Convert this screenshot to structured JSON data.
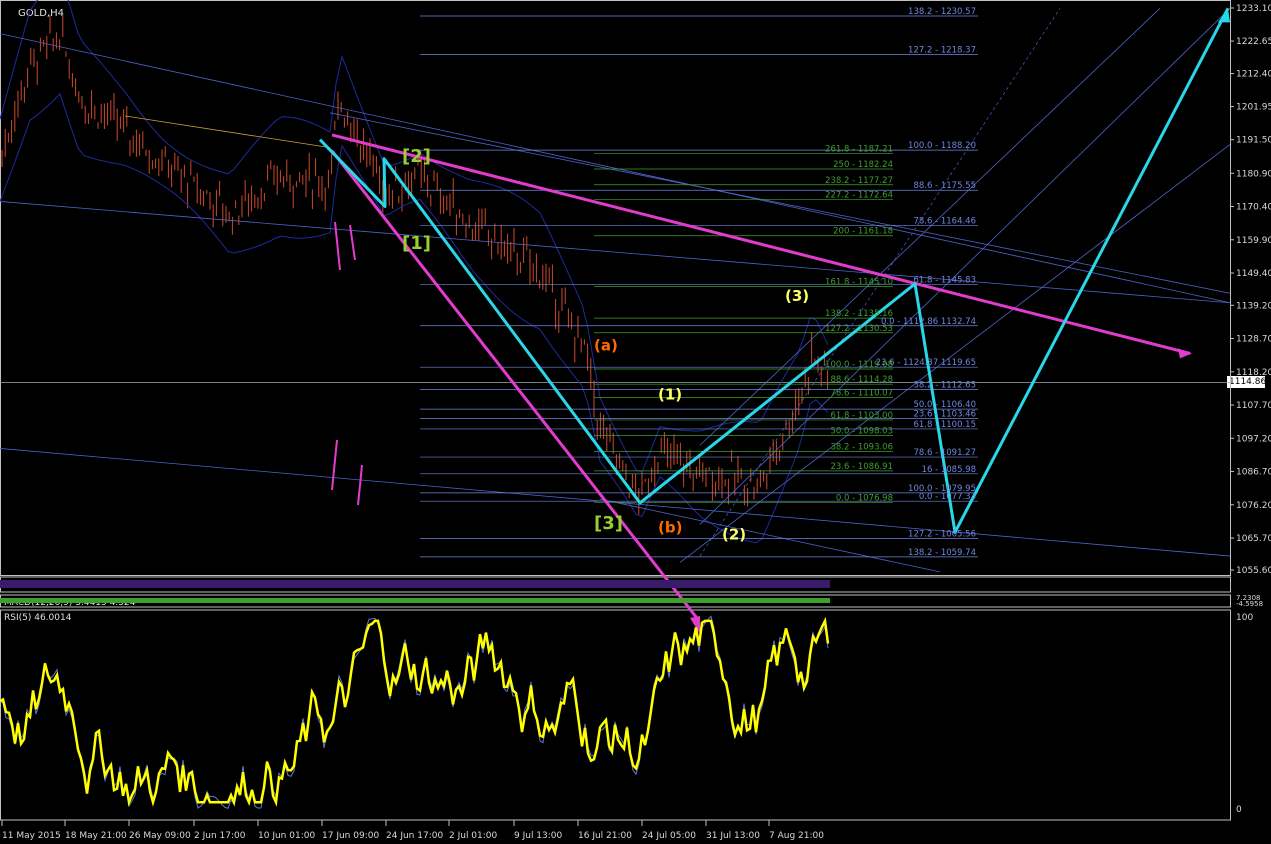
{
  "window": {
    "symbol_label": "GOLD,H4",
    "macd_label": "MACD(12,26,9) 3.4415 4.324",
    "rsi_label": "RSI(5) 46.0014",
    "current_price": "1114.86"
  },
  "colors": {
    "background": "#000000",
    "grid_axis": "#c0c0c0",
    "candle": "#cc4a2b",
    "bollinger": "#1e2a9e",
    "trend_blue": "#4d64c8",
    "fib_blue": "#6f86e0",
    "fib_green": "#3f9f2f",
    "cyan_path": "#28d7e8",
    "magenta": "#e23ccd",
    "rsi_yellow": "#ffff00",
    "rsi_blue": "#5f7bd6",
    "wave_yellow": "#ffff66",
    "wave_orange": "#ff6a00",
    "wave_green": "#9acd32"
  },
  "chart_data": {
    "type": "line",
    "title": "GOLD,H4",
    "price_axis_ticks": [
      "1233.10",
      "1222.65",
      "1212.40",
      "1201.95",
      "1191.50",
      "1180.90",
      "1170.40",
      "1159.90",
      "1149.40",
      "1139.20",
      "1128.70",
      "1118.20",
      "1107.70",
      "1097.20",
      "1086.70",
      "1076.20",
      "1065.70",
      "1055.60"
    ],
    "time_axis_ticks": [
      "11 May 2015",
      "18 May 21:00",
      "26 May 09:00",
      "2 Jun 17:00",
      "10 Jun 01:00",
      "17 Jun 09:00",
      "24 Jun 17:00",
      "2 Jul 01:00",
      "9 Jul 13:00",
      "16 Jul 21:00",
      "24 Jul 05:00",
      "31 Jul 13:00",
      "7 Aug 21:00"
    ],
    "ylim": [
      1055.6,
      1233.1
    ],
    "rsi_ticks": [
      "100",
      "0"
    ],
    "macd_ticks": [
      "7.2308",
      "-4.5958"
    ],
    "fib_levels_right": [
      {
        "label": "138.2 - 1230.57",
        "price": 1230.57
      },
      {
        "label": "127.2 - 1218.37",
        "price": 1218.37
      },
      {
        "label": "100.0 - 1188.20",
        "price": 1188.2
      },
      {
        "label": "88.6 - 1175.55",
        "price": 1175.55
      },
      {
        "label": "78.6 - 1164.46",
        "price": 1164.46
      },
      {
        "label": "61.8 - 1145.83",
        "price": 1145.83
      },
      {
        "label": "0.0 - 1112.86 1132.74",
        "price": 1132.74
      },
      {
        "label": "23.6 - 1124.37 1119.65",
        "price": 1119.65
      },
      {
        "label": "38.2 - 1112.65",
        "price": 1112.65
      },
      {
        "label": "50.0 - 1106.40",
        "price": 1106.4
      },
      {
        "label": "23.6 - 1103.46",
        "price": 1103.46
      },
      {
        "label": "61.8 - 1100.15",
        "price": 1100.15
      },
      {
        "label": "78.6 - 1091.27",
        "price": 1091.27
      },
      {
        "label": "16 - 1085.98",
        "price": 1085.98
      },
      {
        "label": "100.0 - 1079.95",
        "price": 1079.95
      },
      {
        "label": "0.0 - 1077.33",
        "price": 1077.33
      },
      {
        "label": "127.2 - 1065.56",
        "price": 1065.56
      },
      {
        "label": "138.2 - 1059.74",
        "price": 1059.74
      }
    ],
    "fib_levels_green": [
      {
        "label": "261.8 - 1187.21",
        "price": 1187.21
      },
      {
        "label": "250 - 1182.24",
        "price": 1182.24
      },
      {
        "label": "238.2 - 1177.27",
        "price": 1177.27
      },
      {
        "label": "227.2 - 1172.64",
        "price": 1172.64
      },
      {
        "label": "200 - 1161.18",
        "price": 1161.18
      },
      {
        "label": "161.8 - 1145.10",
        "price": 1145.1
      },
      {
        "label": "138.2 - 1135.16",
        "price": 1135.16
      },
      {
        "label": "127.2 - 1130.53",
        "price": 1130.53
      },
      {
        "label": "100.0 - 1119.08",
        "price": 1119.08
      },
      {
        "label": "88.6 - 1114.28",
        "price": 1114.28
      },
      {
        "label": "78.6 - 1110.07",
        "price": 1110.07
      },
      {
        "label": "61.8 - 1103.00",
        "price": 1103.0
      },
      {
        "label": "50.0 - 1098.03",
        "price": 1098.03
      },
      {
        "label": "38.2 - 1093.06",
        "price": 1093.06
      },
      {
        "label": "23.6 - 1086.91",
        "price": 1086.91
      },
      {
        "label": "0.0 - 1076.98",
        "price": 1076.98
      }
    ],
    "wave_labels": [
      {
        "text": "[2]",
        "color": "wave_green",
        "price": 1184.5,
        "x_tick": "24 Jun 17:00"
      },
      {
        "text": "[1]",
        "color": "wave_green",
        "price": 1157.0,
        "x_tick": "24 Jun 17:00"
      },
      {
        "text": "[3]",
        "color": "wave_green",
        "price": 1068.5,
        "x_tick": "16 Jul 21:00"
      },
      {
        "text": "(a)",
        "color": "wave_orange",
        "price": 1125.0,
        "x_tick": "16 Jul 21:00"
      },
      {
        "text": "(b)",
        "color": "wave_orange",
        "price": 1067.5,
        "x_tick": "24 Jul 05:00"
      },
      {
        "text": "(1)",
        "color": "wave_yellow",
        "price": 1109.5,
        "x_tick": "24 Jul 05:00"
      },
      {
        "text": "(2)",
        "color": "wave_yellow",
        "price": 1065.2,
        "x_tick": "31 Jul 13:00"
      },
      {
        "text": "(3)",
        "color": "wave_yellow",
        "price": 1140.5,
        "x_tick": "7 Aug 21:00"
      }
    ],
    "projection_path": [
      {
        "x": "17 Jun 09:00",
        "price": 1191.5
      },
      {
        "x": "17 Jun 17:00",
        "price": 1170.4
      },
      {
        "x": "24 Jun 17:00",
        "price": 1185.5
      },
      {
        "x": "24 Jul 05:00",
        "price": 1076.8
      },
      {
        "x": "21 Aug",
        "price": 1146.0
      },
      {
        "x": "27 Aug",
        "price": 1067.5
      },
      {
        "x": "10 Sep",
        "price": 1233.0
      }
    ]
  }
}
